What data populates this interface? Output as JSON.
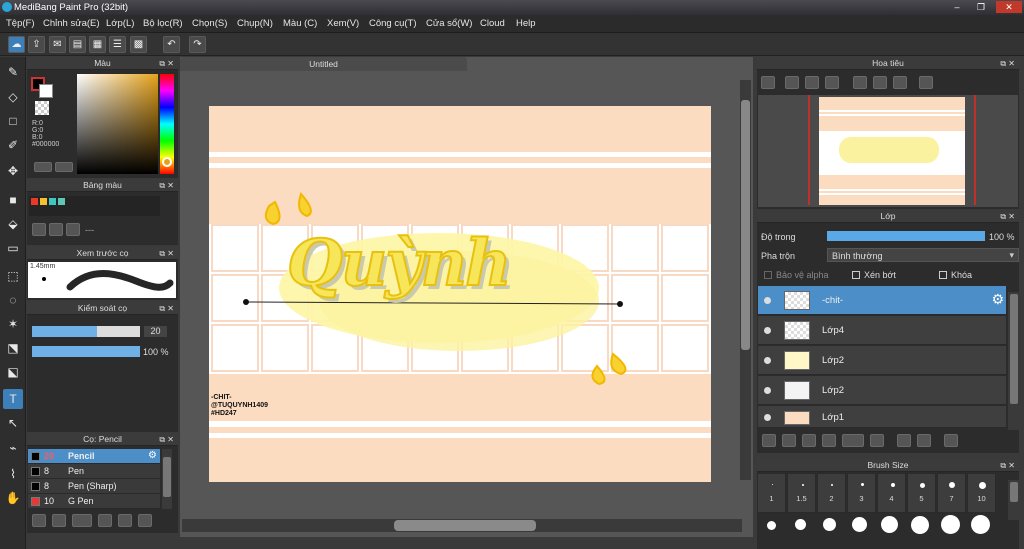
{
  "window": {
    "title": "MediBang Paint Pro (32bit)",
    "controls": [
      "–",
      "❐",
      "✕"
    ]
  },
  "menu": [
    "Tệp(F)",
    "Chỉnh sửa(E)",
    "Lớp(L)",
    "Bộ lọc(R)",
    "Chọn(S)",
    "Chụp(N)",
    "Màu (C)",
    "Xem(V)",
    "Công cụ(T)",
    "Cửa sổ(W)",
    "Cloud",
    "Help"
  ],
  "document": {
    "tab_title": "Untitled"
  },
  "panels": {
    "color": {
      "title": "Màu",
      "rgb": [
        "R:0",
        "G:0",
        "B:0"
      ],
      "hex": "#000000",
      "foreground": "#000000",
      "background": "#ffffff"
    },
    "palette": {
      "title": "Bảng màu",
      "swatches": [
        "#e83a2a",
        "#f5c02c",
        "#3dc7c3",
        "#5ec6b5"
      ],
      "placeholder": "---"
    },
    "brush_preview": {
      "title": "Xem trước cọ",
      "size": "1.45mm"
    },
    "brush_control": {
      "title": "Kiểm soát cọ",
      "size_value": "20",
      "opacity_value": "100 %",
      "size_fraction": 0.6,
      "opacity_fraction": 1.0
    },
    "brush_list": {
      "title": "Cọ: Pencil",
      "items": [
        {
          "size": "20",
          "name": "Pencil",
          "color": "#000000",
          "selected": true
        },
        {
          "size": "8",
          "name": "Pen",
          "color": "#000000",
          "selected": false
        },
        {
          "size": "8",
          "name": "Pen (Sharp)",
          "color": "#000000",
          "selected": false
        },
        {
          "size": "10",
          "name": "G Pen",
          "color": "#e53935",
          "selected": false
        }
      ]
    },
    "navigator": {
      "title": "Hoa tiêu"
    },
    "layers": {
      "title": "Lớp",
      "opacity_label": "Độ trong",
      "opacity_value": "100 %",
      "blend_label": "Pha trộn",
      "blend_value": "Bình thường",
      "protect_alpha": "Bảo vệ alpha",
      "clipping": "Xén bớt",
      "lock": "Khóa",
      "items": [
        {
          "name": "-chit-",
          "selected": true
        },
        {
          "name": "Lớp4",
          "selected": false
        },
        {
          "name": "Lớp2",
          "selected": false
        },
        {
          "name": "Lớp2",
          "selected": false
        },
        {
          "name": "Lớp1",
          "selected": false
        }
      ]
    },
    "brush_size": {
      "title": "Brush Size",
      "labels": [
        "1",
        "1.5",
        "2",
        "3",
        "4",
        "5",
        "7",
        "10"
      ]
    }
  },
  "artwork": {
    "main_text": "Quỳnh",
    "signature": [
      "-CHIT-",
      "@TUQUYNH1409",
      "#HD247"
    ],
    "colors": {
      "paper": "#fcdcc0",
      "yellow": "#f7e55a",
      "glow": "#fdf6a5",
      "outline": "#f2c312"
    }
  }
}
